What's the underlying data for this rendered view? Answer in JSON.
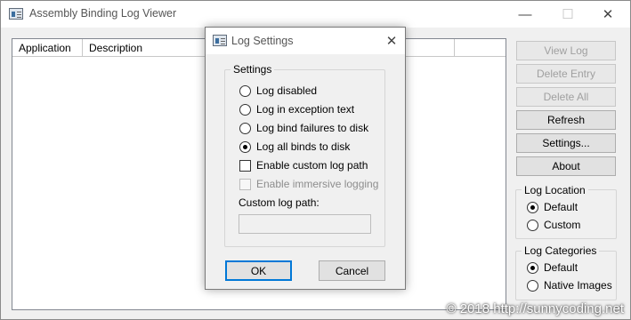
{
  "main_window": {
    "title": "Assembly Binding Log Viewer",
    "minimize_glyph": "—",
    "maximize_glyph": "☐",
    "close_glyph": "✕",
    "columns": [
      "Application",
      "Description",
      "me"
    ],
    "buttons": {
      "view_log": "View Log",
      "delete_entry": "Delete Entry",
      "delete_all": "Delete All",
      "refresh": "Refresh",
      "settings": "Settings...",
      "about": "About"
    },
    "log_location": {
      "label": "Log Location",
      "options": [
        {
          "label": "Default",
          "checked": true
        },
        {
          "label": "Custom",
          "checked": false
        }
      ]
    },
    "log_categories": {
      "label": "Log Categories",
      "options": [
        {
          "label": "Default",
          "checked": true
        },
        {
          "label": "Native Images",
          "checked": false
        }
      ]
    }
  },
  "dialog": {
    "title": "Log Settings",
    "close_glyph": "✕",
    "settings_group_label": "Settings",
    "options": [
      {
        "label": "Log disabled",
        "checked": false
      },
      {
        "label": "Log in exception text",
        "checked": false
      },
      {
        "label": "Log bind failures to disk",
        "checked": false
      },
      {
        "label": "Log all binds to disk",
        "checked": true
      }
    ],
    "enable_custom_log_path": {
      "label": "Enable custom log path",
      "checked": false
    },
    "enable_immersive_logging": {
      "label": "Enable immersive logging",
      "checked": false,
      "enabled": false
    },
    "custom_log_path_label": "Custom log path:",
    "custom_log_path_value": "",
    "ok_label": "OK",
    "cancel_label": "Cancel"
  },
  "watermark": "© 2018 http://sunnycoding.net",
  "colors": {
    "window_bg": "#f0f0f0",
    "titlebar_bg": "#ffffff",
    "default_button_border": "#0078d7",
    "disabled_text": "#a0a0a0"
  }
}
